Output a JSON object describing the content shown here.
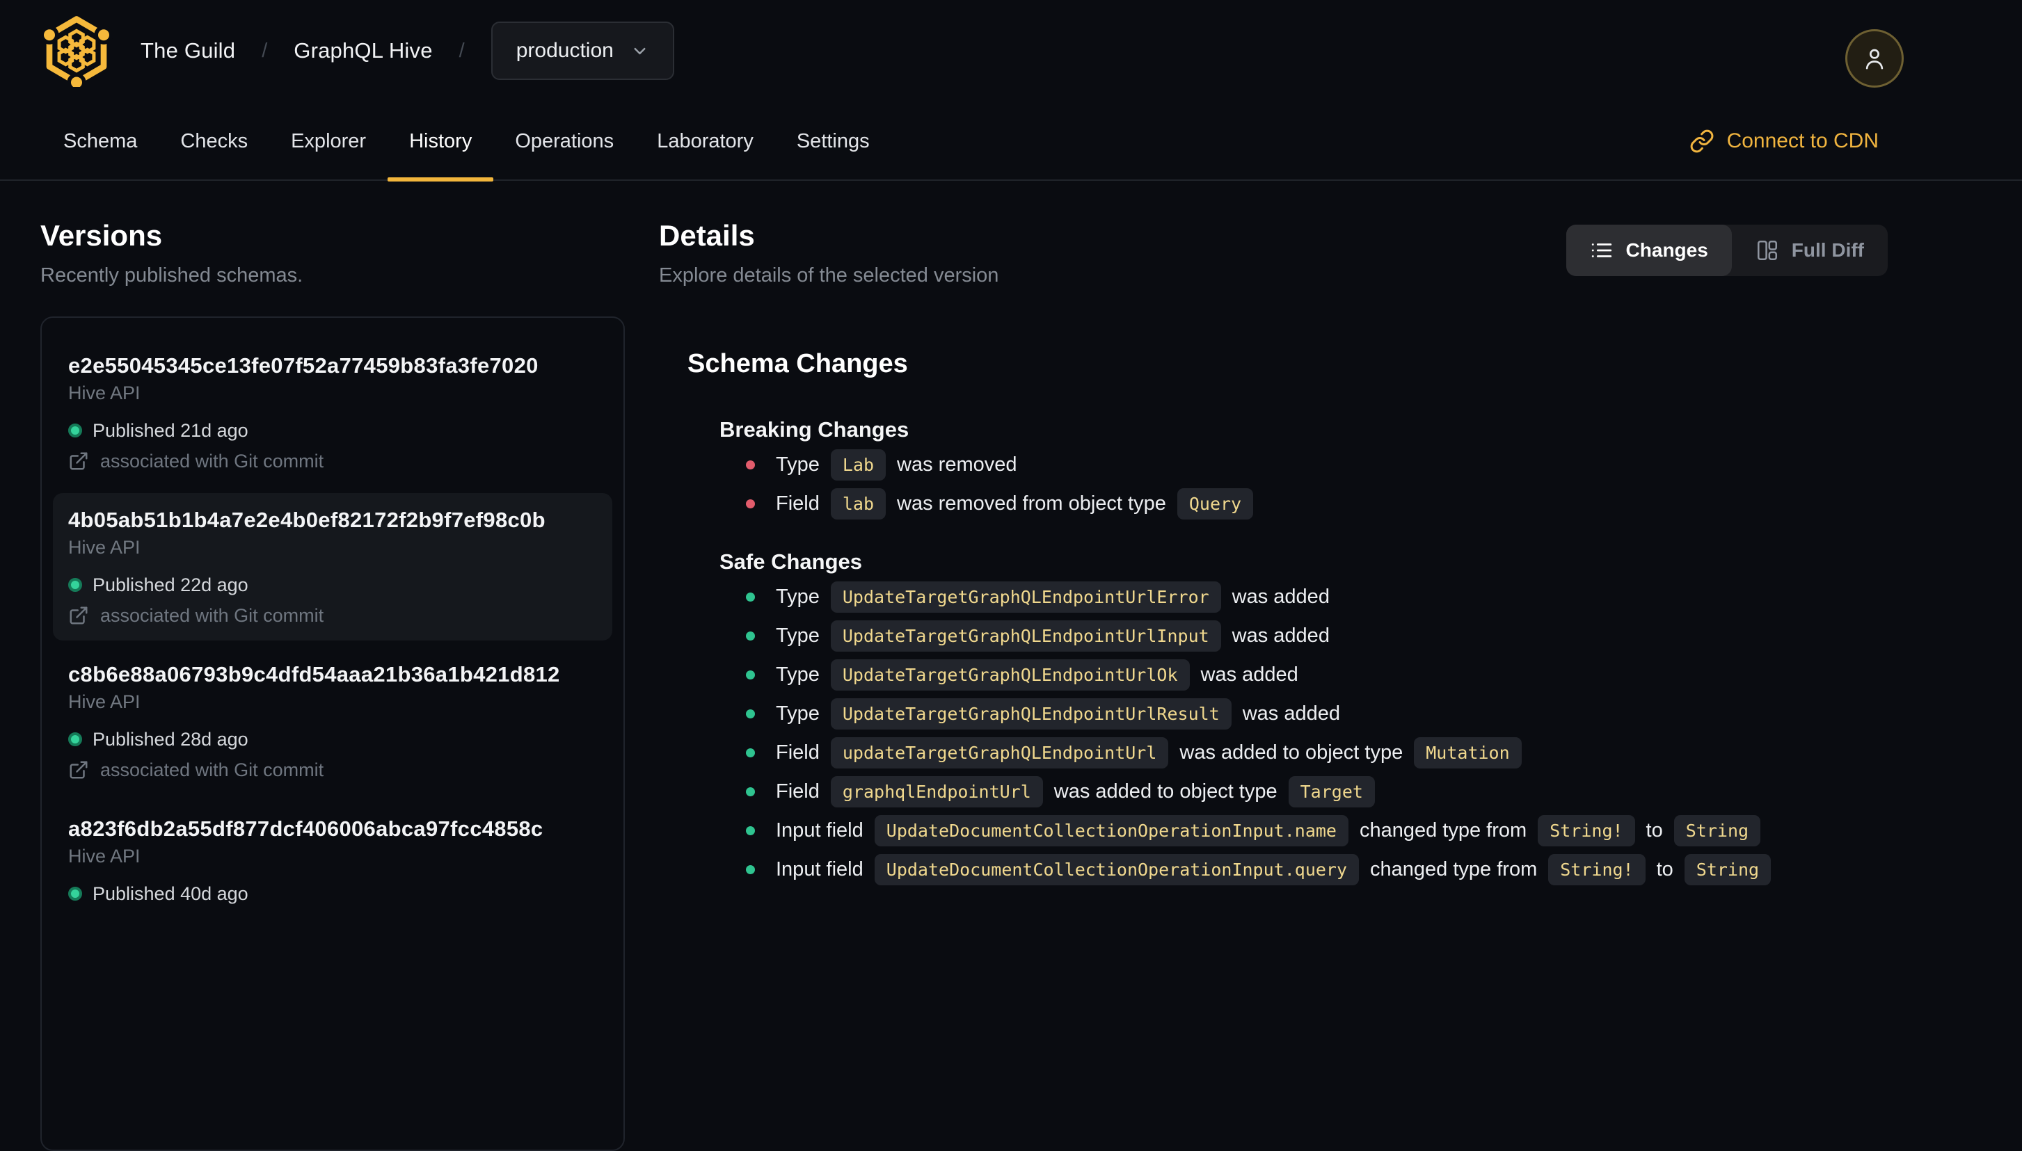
{
  "colors": {
    "accent": "#f2b63c",
    "logo_gold": "#f6b93b",
    "breaking_bullet": "#e25c6c",
    "safe_bullet": "#2fc490",
    "published_dot": "#34d39b",
    "code_text": "#f0d88e"
  },
  "header": {
    "org": "The Guild",
    "separator": "/",
    "project": "GraphQL Hive",
    "target": "production"
  },
  "nav": {
    "tabs": [
      {
        "label": "Schema",
        "active": false
      },
      {
        "label": "Checks",
        "active": false
      },
      {
        "label": "Explorer",
        "active": false
      },
      {
        "label": "History",
        "active": true
      },
      {
        "label": "Operations",
        "active": false
      },
      {
        "label": "Laboratory",
        "active": false
      },
      {
        "label": "Settings",
        "active": false
      }
    ],
    "cdn_link_label": "Connect to CDN"
  },
  "versions": {
    "title": "Versions",
    "subtitle": "Recently published schemas.",
    "items": [
      {
        "hash": "e2e55045345ce13fe07f52a77459b83fa3fe7020",
        "service": "Hive API",
        "published": "Published 21d ago",
        "git": "associated with Git commit",
        "selected": false
      },
      {
        "hash": "4b05ab51b1b4a7e2e4b0ef82172f2b9f7ef98c0b",
        "service": "Hive API",
        "published": "Published 22d ago",
        "git": "associated with Git commit",
        "selected": true
      },
      {
        "hash": "c8b6e88a06793b9c4dfd54aaa21b36a1b421d812",
        "service": "Hive API",
        "published": "Published 28d ago",
        "git": "associated with Git commit",
        "selected": false
      },
      {
        "hash": "a823f6db2a55df877dcf406006abca97fcc4858c",
        "service": "Hive API",
        "published": "Published 40d ago",
        "git": null,
        "selected": false
      }
    ]
  },
  "details": {
    "title": "Details",
    "subtitle": "Explore details of the selected version",
    "toggle": {
      "changes": "Changes",
      "full_diff": "Full Diff"
    },
    "schema_changes_title": "Schema Changes",
    "breaking": {
      "title": "Breaking Changes",
      "items": [
        [
          {
            "text": "Type"
          },
          {
            "code": "Lab"
          },
          {
            "text": "was removed"
          }
        ],
        [
          {
            "text": "Field"
          },
          {
            "code": "lab"
          },
          {
            "text": "was removed from object type"
          },
          {
            "code": "Query"
          }
        ]
      ]
    },
    "safe": {
      "title": "Safe Changes",
      "items": [
        [
          {
            "text": "Type"
          },
          {
            "code": "UpdateTargetGraphQLEndpointUrlError"
          },
          {
            "text": "was added"
          }
        ],
        [
          {
            "text": "Type"
          },
          {
            "code": "UpdateTargetGraphQLEndpointUrlInput"
          },
          {
            "text": "was added"
          }
        ],
        [
          {
            "text": "Type"
          },
          {
            "code": "UpdateTargetGraphQLEndpointUrlOk"
          },
          {
            "text": "was added"
          }
        ],
        [
          {
            "text": "Type"
          },
          {
            "code": "UpdateTargetGraphQLEndpointUrlResult"
          },
          {
            "text": "was added"
          }
        ],
        [
          {
            "text": "Field"
          },
          {
            "code": "updateTargetGraphQLEndpointUrl"
          },
          {
            "text": "was added to object type"
          },
          {
            "code": "Mutation"
          }
        ],
        [
          {
            "text": "Field"
          },
          {
            "code": "graphqlEndpointUrl"
          },
          {
            "text": "was added to object type"
          },
          {
            "code": "Target"
          }
        ],
        [
          {
            "text": "Input field"
          },
          {
            "code": "UpdateDocumentCollectionOperationInput.name"
          },
          {
            "text": "changed type from"
          },
          {
            "code": "String!"
          },
          {
            "text": "to"
          },
          {
            "code": "String"
          }
        ],
        [
          {
            "text": "Input field"
          },
          {
            "code": "UpdateDocumentCollectionOperationInput.query"
          },
          {
            "text": "changed type from"
          },
          {
            "code": "String!"
          },
          {
            "text": "to"
          },
          {
            "code": "String"
          }
        ]
      ]
    }
  }
}
